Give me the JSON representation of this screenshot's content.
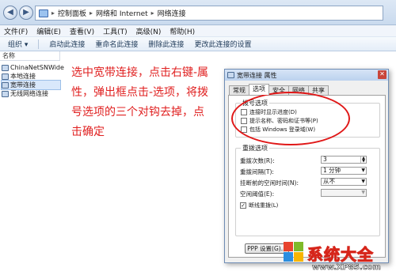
{
  "address": {
    "crumbs": [
      "控制面板",
      "网络和 Internet",
      "网络连接"
    ]
  },
  "menu": [
    "文件(F)",
    "编辑(E)",
    "查看(V)",
    "工具(T)",
    "高级(N)",
    "帮助(H)"
  ],
  "commands": [
    "组织 ▾",
    "启动此连接",
    "重命名此连接",
    "删除此连接",
    "更改此连接的设置"
  ],
  "list": {
    "column": "名称",
    "items": [
      "ChinaNetSNWide",
      "本地连接",
      "宽带连接",
      "无线网络连接"
    ]
  },
  "annotation": "选中宽带连接，点击右键-属性，弹出框点击-选项，将拨号选项的三个对钩去掉，点击确定",
  "dialog": {
    "title": "宽带连接 属性",
    "tabs": [
      "常规",
      "选项",
      "安全",
      "网络",
      "共享"
    ],
    "dial_group": {
      "title": "拨号选项",
      "options": [
        "连接时显示进度(D)",
        "提示名称、密码和证书等(P)",
        "包括 Windows 登录域(W)"
      ]
    },
    "redial_group": {
      "title": "重拨选项",
      "attempts_label": "重拨次数(R):",
      "attempts_value": "3",
      "interval_label": "重拨间隔(T):",
      "interval_value": "1 分钟",
      "idle_label": "挂断前的空闲时间(N):",
      "idle_value": "从不",
      "threshold_label": "空闲阈值(E):",
      "redial_label": "断线重拨(L)"
    },
    "ppp_button": "PPP 设置(G)..."
  },
  "watermark": {
    "brand": "系统大全",
    "url": "www.XP85.com"
  }
}
